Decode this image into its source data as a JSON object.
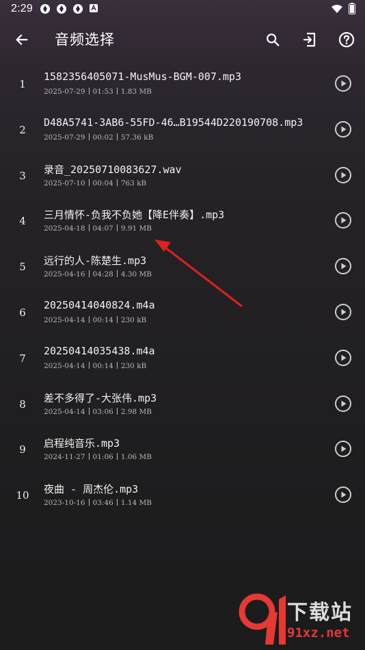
{
  "status_bar": {
    "time": "2:29"
  },
  "app_bar": {
    "title": "音频选择"
  },
  "files": [
    {
      "index": "1",
      "name": "1582356405071-MusMus-BGM-007.mp3",
      "date": "2025-07-29",
      "duration": "01:53",
      "size": "1.83 MB"
    },
    {
      "index": "2",
      "name": "D48A5741-3AB6-55FD-46…B19544D220190708.mp3",
      "date": "2025-07-29",
      "duration": "00:02",
      "size": "57.36 kB"
    },
    {
      "index": "3",
      "name": "录音_20250710083627.wav",
      "date": "2025-07-10",
      "duration": "00:04",
      "size": "763 kB"
    },
    {
      "index": "4",
      "name": "三月情怀-负我不负她【降E伴奏】.mp3",
      "date": "2025-04-18",
      "duration": "04:07",
      "size": "9.91 MB"
    },
    {
      "index": "5",
      "name": "远行的人-陈楚生.mp3",
      "date": "2025-04-16",
      "duration": "04:28",
      "size": "4.30 MB"
    },
    {
      "index": "6",
      "name": "20250414040824.m4a",
      "date": "2025-04-14",
      "duration": "00:14",
      "size": "230 kB"
    },
    {
      "index": "7",
      "name": "20250414035438.m4a",
      "date": "2025-04-14",
      "duration": "00:14",
      "size": "230 kB"
    },
    {
      "index": "8",
      "name": "差不多得了-大张伟.mp3",
      "date": "2025-04-14",
      "duration": "03:06",
      "size": "2.98 MB"
    },
    {
      "index": "9",
      "name": "启程纯音乐.mp3",
      "date": "2024-11-27",
      "duration": "01:06",
      "size": "1.06 MB"
    },
    {
      "index": "10",
      "name": "夜曲 - 周杰伦.mp3",
      "date": "2023-10-16",
      "duration": "03:46",
      "size": "1.14 MB"
    }
  ],
  "watermark": {
    "top": "下载站",
    "bottom": "91xz.net"
  },
  "colors": {
    "annotation_arrow": "#e0201f",
    "icon_tint": "#ffffff",
    "play_icon": "#cfcfcf"
  },
  "icons": {
    "back": "arrow-left-icon",
    "search": "search-icon",
    "import": "import-file-icon",
    "help": "help-circle-icon",
    "play": "play-circle-icon"
  }
}
